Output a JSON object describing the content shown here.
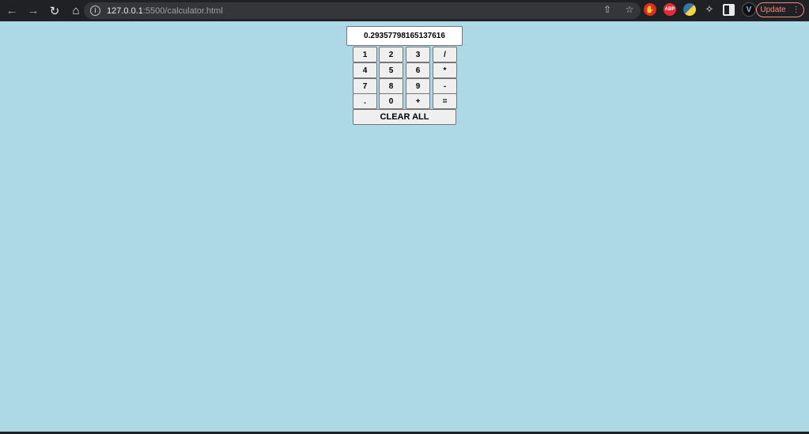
{
  "browser": {
    "url_host": "127.0.0.1",
    "url_rest": ":5500/calculator.html",
    "update_label": "Update",
    "abp_label": "ABP"
  },
  "calculator": {
    "display_value": "0.29357798165137616",
    "keys": [
      "1",
      "2",
      "3",
      "/",
      "4",
      "5",
      "6",
      "*",
      "7",
      "8",
      "9",
      "-",
      ".",
      "0",
      "+",
      "="
    ],
    "clear_label": "CLEAR ALL"
  },
  "colors": {
    "page_background": "#add8e6",
    "chrome_background": "#202124",
    "button_background": "#efefef"
  }
}
